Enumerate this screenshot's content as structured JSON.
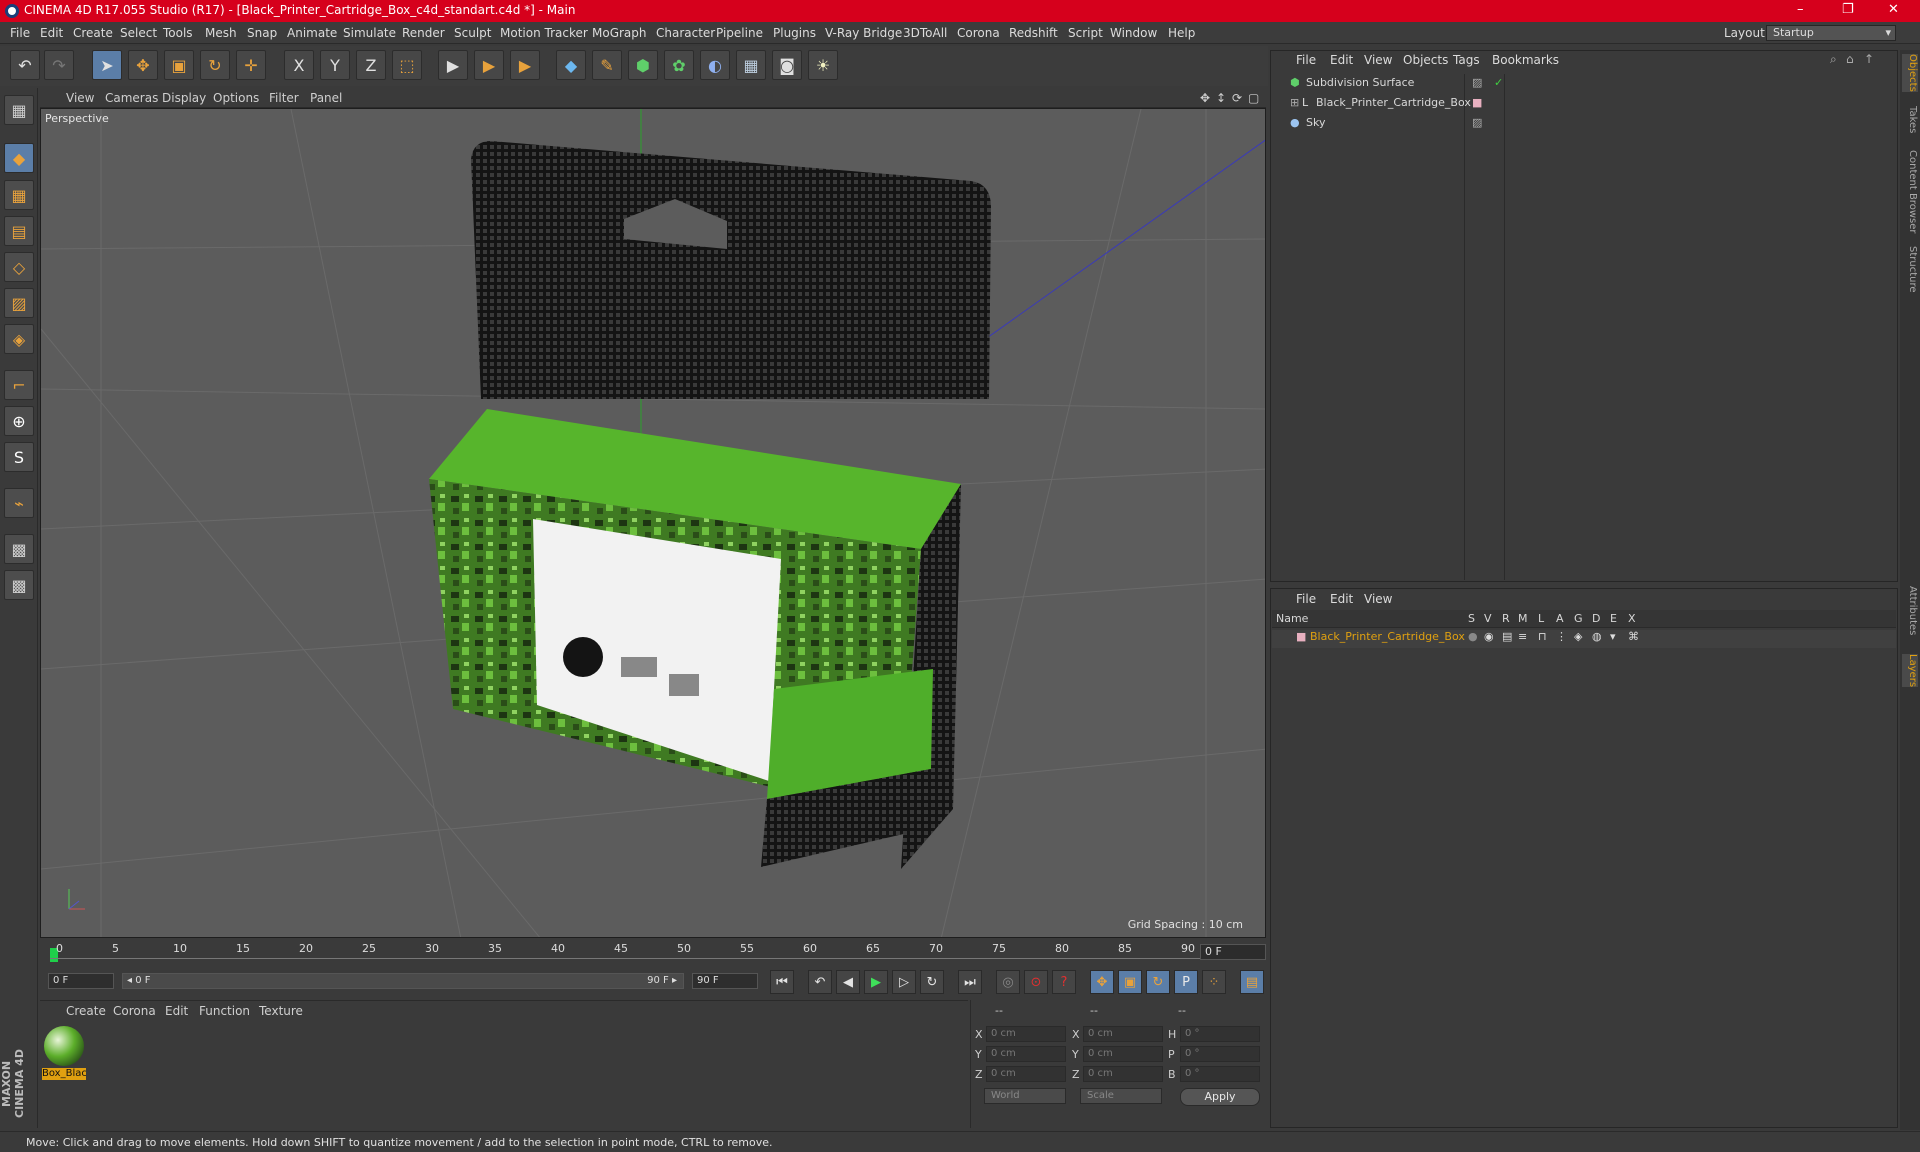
{
  "window": {
    "title": "CINEMA 4D R17.055 Studio (R17) - [Black_Printer_Cartridge_Box_c4d_standart.c4d *] - Main",
    "controls": [
      "–",
      "❐",
      "✕"
    ]
  },
  "menu": [
    "File",
    "Edit",
    "Create",
    "Select",
    "Tools",
    "Mesh",
    "Snap",
    "Animate",
    "Simulate",
    "Render",
    "Sculpt",
    "Motion Tracker",
    "MoGraph",
    "Character",
    "Pipeline",
    "Plugins",
    "V-Ray Bridge",
    "3DToAll",
    "Corona",
    "Redshift",
    "Script",
    "Window",
    "Help"
  ],
  "layout": {
    "label": "Layout:",
    "value": "Startup"
  },
  "toolbar_icons": [
    "undo-icon",
    "redo-icon",
    "select-arrow-icon",
    "move-icon",
    "scale-icon",
    "rotate-icon",
    "move-plus-icon",
    "x-axis-icon",
    "y-axis-icon",
    "z-axis-icon",
    "world-coord-icon",
    "render-view-icon",
    "render-picture-queue-icon",
    "render-settings-icon",
    "cube-icon",
    "pen-icon",
    "subdivide-icon",
    "cloner-icon",
    "deformer-icon",
    "floor-icon",
    "camera-icon",
    "light-icon"
  ],
  "toolbar_glyphs": {
    "undo": "↶",
    "redo": "↷",
    "select": "➤",
    "move": "✥",
    "scale": "▣",
    "rotate": "↻",
    "plus": "✛",
    "x": "X",
    "y": "Y",
    "z": "Z",
    "coord": "⬚",
    "r1": "▶",
    "r2": "▶",
    "r3": "▶",
    "cube": "◆",
    "pen": "✎",
    "sub": "⬢",
    "clone": "✿",
    "deform": "◐",
    "floor": "▦",
    "cam": "◙",
    "light": "☀"
  },
  "left_tools": [
    "◆",
    "▦",
    "▤",
    "◇",
    "▨",
    "◈",
    "⌐",
    "⊕",
    "S",
    "⌁",
    "▩",
    "▩"
  ],
  "viewport": {
    "menu": [
      "View",
      "Cameras",
      "Display",
      "Options",
      "Filter",
      "Panel"
    ],
    "label": "Perspective",
    "grid_spacing": "Grid Spacing : 10 cm",
    "nav_icons": [
      "✥",
      "↕",
      "⟳",
      "▢"
    ],
    "colors": {
      "bg": "#5c5c5c",
      "box_green": "#4fae2a",
      "box_dark": "#1e1e1e",
      "label_white": "#f2f2f2"
    }
  },
  "timeline": {
    "ticks": [
      "0",
      "5",
      "10",
      "15",
      "20",
      "25",
      "30",
      "35",
      "40",
      "45",
      "50",
      "55",
      "60",
      "65",
      "70",
      "75",
      "80",
      "85",
      "90"
    ],
    "current_frame": "0 F"
  },
  "transport": {
    "start": "0 F",
    "slider_start": "◂ 0 F",
    "slider_end": "90 F ▸",
    "end": "90 F",
    "buttons": [
      "⏮",
      "↶",
      "◀",
      "▶",
      "▷",
      "↻",
      "⏭"
    ],
    "record_buttons": [
      "◎",
      "⊙",
      "?",
      "✥",
      "▣",
      "↻",
      "P",
      "⁘",
      "▤"
    ]
  },
  "material_panel": {
    "menu": [
      "Create",
      "Corona",
      "Edit",
      "Function",
      "Texture"
    ],
    "material_name": "Box_Blac"
  },
  "coord_panel": {
    "headers": [
      "--",
      "--",
      "--"
    ],
    "rows": [
      {
        "axis": "X",
        "pos": "0 cm",
        "axis2": "X",
        "size": "0 cm",
        "rlabel": "H",
        "rot": "0 °"
      },
      {
        "axis": "Y",
        "pos": "0 cm",
        "axis2": "Y",
        "size": "0 cm",
        "rlabel": "P",
        "rot": "0 °"
      },
      {
        "axis": "Z",
        "pos": "0 cm",
        "axis2": "Z",
        "size": "0 cm",
        "rlabel": "B",
        "rot": "0 °"
      }
    ],
    "mode1": "World",
    "mode2": "Scale",
    "apply": "Apply"
  },
  "object_panel": {
    "menu": [
      "File",
      "Edit",
      "View",
      "Objects",
      "Tags",
      "Bookmarks"
    ],
    "objects": [
      {
        "name": "Subdivision Surface",
        "icon": "subdivision-icon"
      },
      {
        "name": "Black_Printer_Cartridge_Box",
        "icon": "null-object-icon"
      },
      {
        "name": "Sky",
        "icon": "sky-icon"
      }
    ]
  },
  "layer_panel": {
    "menu": [
      "File",
      "Edit",
      "View"
    ],
    "columns": [
      "Name",
      "S",
      "V",
      "R",
      "M",
      "L",
      "A",
      "G",
      "D",
      "E",
      "X"
    ],
    "layers": [
      {
        "name": "Black_Printer_Cartridge_Box",
        "color": "#e0a010"
      }
    ]
  },
  "right_tabs": [
    "Objects",
    "Takes",
    "Content Browser",
    "Structure",
    "Attributes",
    "Layers"
  ],
  "status": "Move: Click and drag to move elements. Hold down SHIFT to quantize movement / add to the selection in point mode, CTRL to remove.",
  "brand": "MAXON CINEMA 4D"
}
